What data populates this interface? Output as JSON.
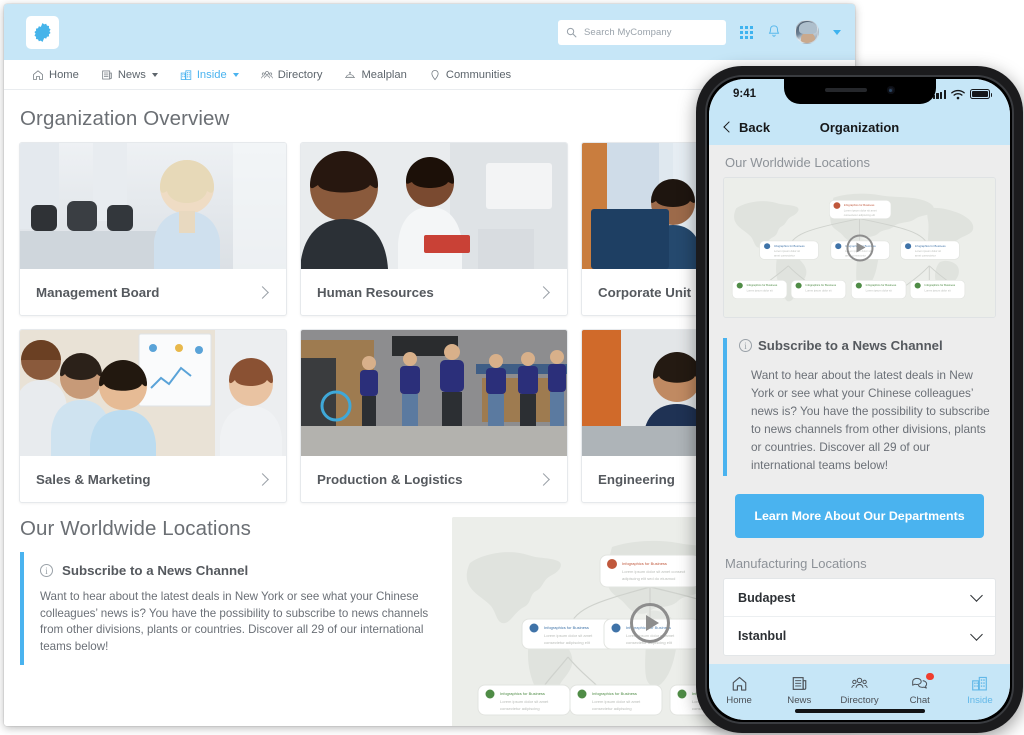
{
  "desktop": {
    "header": {
      "logo_icon": "starburst-logo-icon",
      "search": {
        "placeholder": "Search MyCompany",
        "value": "",
        "icon": "search-icon"
      },
      "apps_icon": "apps-grid-icon",
      "notifications_icon": "bell-icon",
      "avatar_icon": "user-avatar",
      "account_caret_icon": "chevron-down-icon"
    },
    "nav": {
      "items": [
        {
          "label": "Home",
          "icon": "home-icon",
          "active": false,
          "has_chevron": false
        },
        {
          "label": "News",
          "icon": "news-icon",
          "active": false,
          "has_chevron": true
        },
        {
          "label": "Inside",
          "icon": "building-icon",
          "active": true,
          "has_chevron": true
        },
        {
          "label": "Directory",
          "icon": "people-icon",
          "active": false,
          "has_chevron": false
        },
        {
          "label": "Mealplan",
          "icon": "meal-icon",
          "active": false,
          "has_chevron": false
        },
        {
          "label": "Communities",
          "icon": "location-pin-icon",
          "active": false,
          "has_chevron": false
        }
      ]
    },
    "overview": {
      "title": "Organization Overview",
      "cards": [
        {
          "label": "Management Board",
          "arrow_icon": "chevron-right-icon"
        },
        {
          "label": "Human Resources",
          "arrow_icon": "chevron-right-icon"
        },
        {
          "label": "Corporate Unit",
          "arrow_icon": "chevron-right-icon"
        },
        {
          "label": "Sales & Marketing",
          "arrow_icon": "chevron-right-icon"
        },
        {
          "label": "Production & Logistics",
          "arrow_icon": "chevron-right-icon"
        },
        {
          "label": "Engineering",
          "arrow_icon": "chevron-right-icon"
        }
      ]
    },
    "locations": {
      "title": "Our Worldwide Locations",
      "info": {
        "icon": "info-circle-icon",
        "heading": "Subscribe to a News Channel",
        "body": "Want to hear about the latest deals in New York or see what your Chinese colleagues’ news is? You have the possibility to subscribe to news channels from other divisions, plants or countries. Discover all 29 of our international teams below!"
      },
      "map": {
        "play_icon": "play-button-icon",
        "alt": "world-map-infographic"
      }
    }
  },
  "phone": {
    "status": {
      "time": "9:41",
      "signal_icon": "cellular-signal-icon",
      "wifi_icon": "wifi-icon",
      "battery_icon": "battery-full-icon"
    },
    "nav": {
      "back_label": "Back",
      "back_icon": "chevron-left-icon",
      "title": "Organization"
    },
    "sections": {
      "locations_title": "Our Worldwide Locations",
      "manufacturing_title": "Manufacturing Locations"
    },
    "map": {
      "play_icon": "play-button-icon",
      "alt": "world-map-infographic"
    },
    "info": {
      "icon": "info-circle-icon",
      "heading": "Subscribe to a News Channel",
      "body": "Want to hear about the latest deals in New York or see what your Chinese colleagues’ news is? You have the possibility to subscribe to news channels from other divisions, plants or countries. Discover all 29 of our international teams below!"
    },
    "cta": {
      "label": "Learn More About Our Departments"
    },
    "manufacturing_list": [
      {
        "label": "Budapest",
        "chevron_icon": "chevron-down-icon"
      },
      {
        "label": "Istanbul",
        "chevron_icon": "chevron-down-icon"
      }
    ],
    "tabbar": [
      {
        "label": "Home",
        "icon": "home-icon",
        "active": false,
        "badge": false
      },
      {
        "label": "News",
        "icon": "news-icon",
        "active": false,
        "badge": false
      },
      {
        "label": "Directory",
        "icon": "people-icon",
        "active": false,
        "badge": false
      },
      {
        "label": "Chat",
        "icon": "chat-icon",
        "active": false,
        "badge": true
      },
      {
        "label": "Inside",
        "icon": "building-icon",
        "active": true,
        "badge": false
      }
    ]
  },
  "colors": {
    "header_blue": "#c6e6f7",
    "accent_blue": "#4ab3ef",
    "text_gray": "#6b7077",
    "badge_red": "#ef3d2e",
    "map_bg": "#eceeea"
  }
}
